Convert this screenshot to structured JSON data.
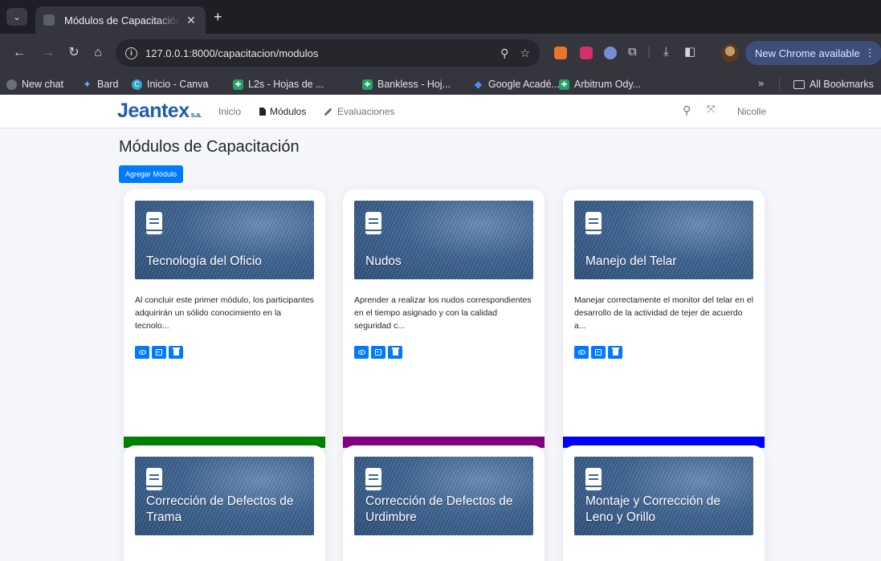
{
  "browser": {
    "tab": {
      "title": "Módulos de Capacitación"
    },
    "url": "127.0.0.1:8000/capacitacion/modulos",
    "update_label": "New Chrome available",
    "bookmarks": [
      {
        "label": "New chat",
        "icon_color": "#6b6f78"
      },
      {
        "label": "Bard",
        "icon_color": "#7aa7ff"
      },
      {
        "label": "Inicio - Canva",
        "icon_color": "#2fa6d4"
      },
      {
        "label": "L2s - Hojas de ...",
        "icon_color": "#1fa463"
      },
      {
        "label": "Bankless - Hoj...",
        "icon_color": "#1fa463"
      },
      {
        "label": "Google Acadé...",
        "icon_color": "#4f8ff7"
      },
      {
        "label": "Arbitrum Ody...",
        "icon_color": "#1fa463"
      }
    ],
    "more_label": "»",
    "all_bookmarks_label": "All Bookmarks"
  },
  "navbar": {
    "brand": "Jeantex",
    "brand_suffix": "s.a.",
    "links": {
      "inicio": "Inicio",
      "modulos": "Módulos",
      "evaluaciones": "Evaluaciones"
    },
    "user": "Nicolle"
  },
  "page": {
    "title": "Módulos de Capacitación",
    "add_button": "Agregar Módulo"
  },
  "modules": [
    {
      "title": "Tecnología del Oficio",
      "description": "Al concluir este primer módulo, los participantes adquirirán un sólido conocimiento en la tecnolo...",
      "color": "#008000"
    },
    {
      "title": "Nudos",
      "description": "Aprender a realizar los nudos correspondientes en el tiempo asignado y con la calidad seguridad c...",
      "color": "#800080"
    },
    {
      "title": "Manejo del Telar",
      "description": "Manejar correctamente el monitor del telar en el desarrollo de la actividad de tejer de acuerdo a...",
      "color": "#0000ff"
    },
    {
      "title": "Corrección de Defectos de Trama"
    },
    {
      "title": "Corrección de Defectos de Urdimbre"
    },
    {
      "title": "Montaje y Corrección de Leno y Orillo"
    }
  ]
}
